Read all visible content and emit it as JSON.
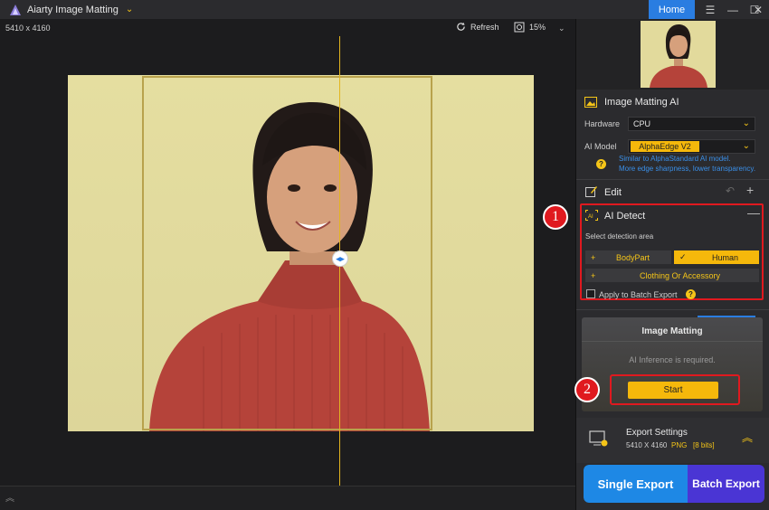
{
  "titlebar": {
    "app_title": "Aiarty Image Matting",
    "home_label": "Home"
  },
  "canvas": {
    "dimensions": "5410 x 4160",
    "refresh_label": "Refresh",
    "zoom_label": "15%"
  },
  "panel": {
    "matting_ai": {
      "title": "Image Matting AI",
      "hardware_label": "Hardware",
      "hardware_value": "CPU",
      "model_label": "AI Model",
      "model_value": "AlphaEdge  V2",
      "note_line1": "Similar to AlphaStandard AI model.",
      "note_line2": "More edge sharpness, lower transparency."
    },
    "edit": {
      "title": "Edit"
    },
    "ai_detect": {
      "title": "AI Detect",
      "prompt": "Select detection area",
      "bodypart": "BodyPart",
      "human": "Human",
      "clothing": "Clothing Or Accessory",
      "apply_batch": "Apply to Batch Export"
    },
    "callouts": {
      "one": "1",
      "two": "2"
    },
    "image_matting": {
      "title": "Image Matting",
      "status": "AI Inference is required.",
      "start_label": "Start"
    },
    "export": {
      "title": "Export Settings",
      "size": "5410 X 4160",
      "format": "PNG",
      "bits": "[8 bits]",
      "single_label": "Single Export",
      "batch_label": "Batch Export"
    }
  },
  "colors": {
    "accent": "#f5b80b",
    "brand_blue": "#2a7de1",
    "callout_red": "#e0191f",
    "batch_purple": "#4a35d4"
  }
}
